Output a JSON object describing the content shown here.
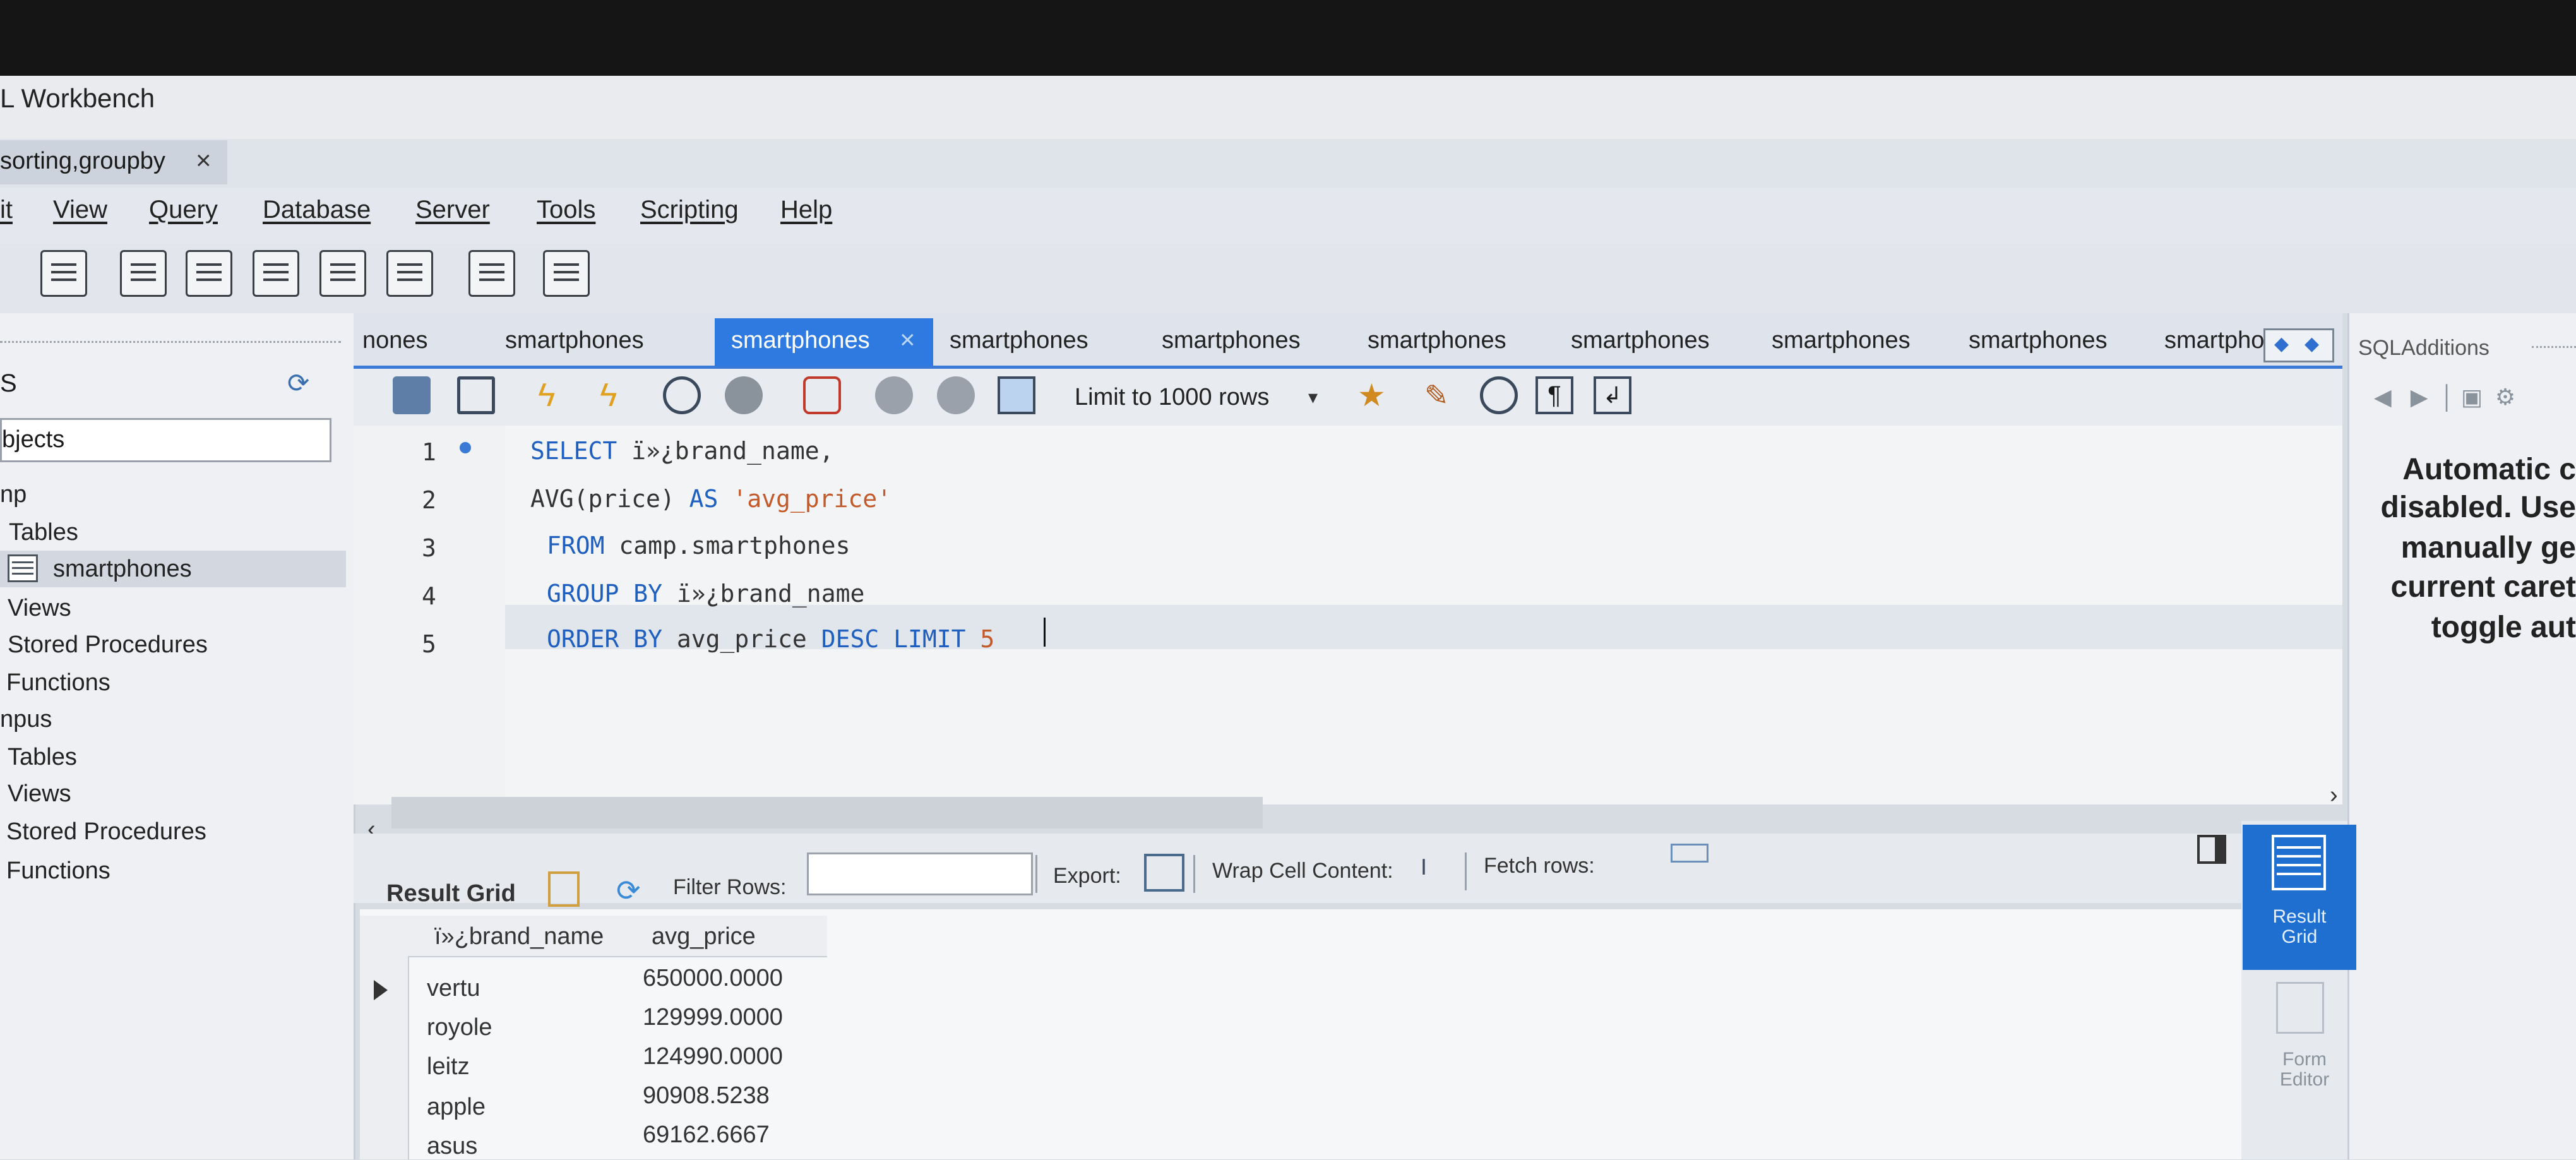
{
  "window": {
    "title": "L Workbench"
  },
  "file_tab": {
    "label": "sorting,groupby",
    "close": "×"
  },
  "menu": [
    "it",
    "View",
    "Query",
    "Database",
    "Server",
    "Tools",
    "Scripting",
    "Help"
  ],
  "navigator": {
    "header_label": "S",
    "filter_text": "bjects",
    "tree": [
      {
        "label": "np",
        "level": 0
      },
      {
        "label": "Tables",
        "level": 1
      },
      {
        "label": "smartphones",
        "level": 2,
        "selected": true
      },
      {
        "label": "Views",
        "level": 1
      },
      {
        "label": "Stored Procedures",
        "level": 1
      },
      {
        "label": "Functions",
        "level": 1
      },
      {
        "label": "npus",
        "level": 0
      },
      {
        "label": "Tables",
        "level": 1
      },
      {
        "label": "Views",
        "level": 1
      },
      {
        "label": "Stored Procedures",
        "level": 1
      },
      {
        "label": "Functions",
        "level": 1
      }
    ]
  },
  "query_tabs": [
    "nones",
    "smartphones",
    "smartphones",
    "smartphones",
    "smartphones",
    "smartphones",
    "smartphones",
    "smartphones",
    "smartphones",
    "smartpho"
  ],
  "active_tab": {
    "label": "smartphones",
    "close": "×"
  },
  "editor_toolbar": {
    "limit_label": "Limit to 1000 rows"
  },
  "editor": {
    "line_numbers": [
      "1",
      "2",
      "3",
      "4",
      "5"
    ],
    "lines": [
      {
        "kw": "SELECT",
        "rest": " ï»¿brand_name,"
      },
      {
        "kw": "",
        "rest": "AVG(price) ",
        "kw2": "AS",
        "str": " 'avg_price'"
      },
      {
        "kw": "FROM",
        "rest": " camp.smartphones"
      },
      {
        "kw": "GROUP BY",
        "rest": " ï»¿brand_name"
      },
      {
        "kw": "ORDER BY",
        "rest": " avg_price ",
        "kw2": "DESC LIMIT",
        "rest2": " 5"
      }
    ]
  },
  "sql_additions": {
    "title": "SQLAdditions",
    "text_lines": [
      "Automatic c",
      "disabled. Use",
      "manually ge",
      "current caret",
      "toggle aut"
    ]
  },
  "result_toolbar": {
    "result_grid": "Result Grid",
    "filter_rows": "Filter Rows:",
    "export": "Export:",
    "wrap_cell": "Wrap Cell Content:",
    "fetch_rows": "Fetch rows:"
  },
  "result_grid": {
    "columns": [
      "ï»¿brand_name",
      "avg_price"
    ],
    "rows": [
      [
        "vertu",
        "650000.0000"
      ],
      [
        "royole",
        "129999.0000"
      ],
      [
        "leitz",
        "124990.0000"
      ],
      [
        "apple",
        "90908.5238"
      ],
      [
        "asus",
        "69162.6667"
      ]
    ]
  },
  "side_buttons": {
    "result_grid_line1": "Result",
    "result_grid_line2": "Grid",
    "form_editor_line1": "Form",
    "form_editor_line2": "Editor"
  },
  "colors": {
    "accent": "#2e7ae0",
    "keyword": "#1e5fbf",
    "string": "#c35a2a"
  }
}
